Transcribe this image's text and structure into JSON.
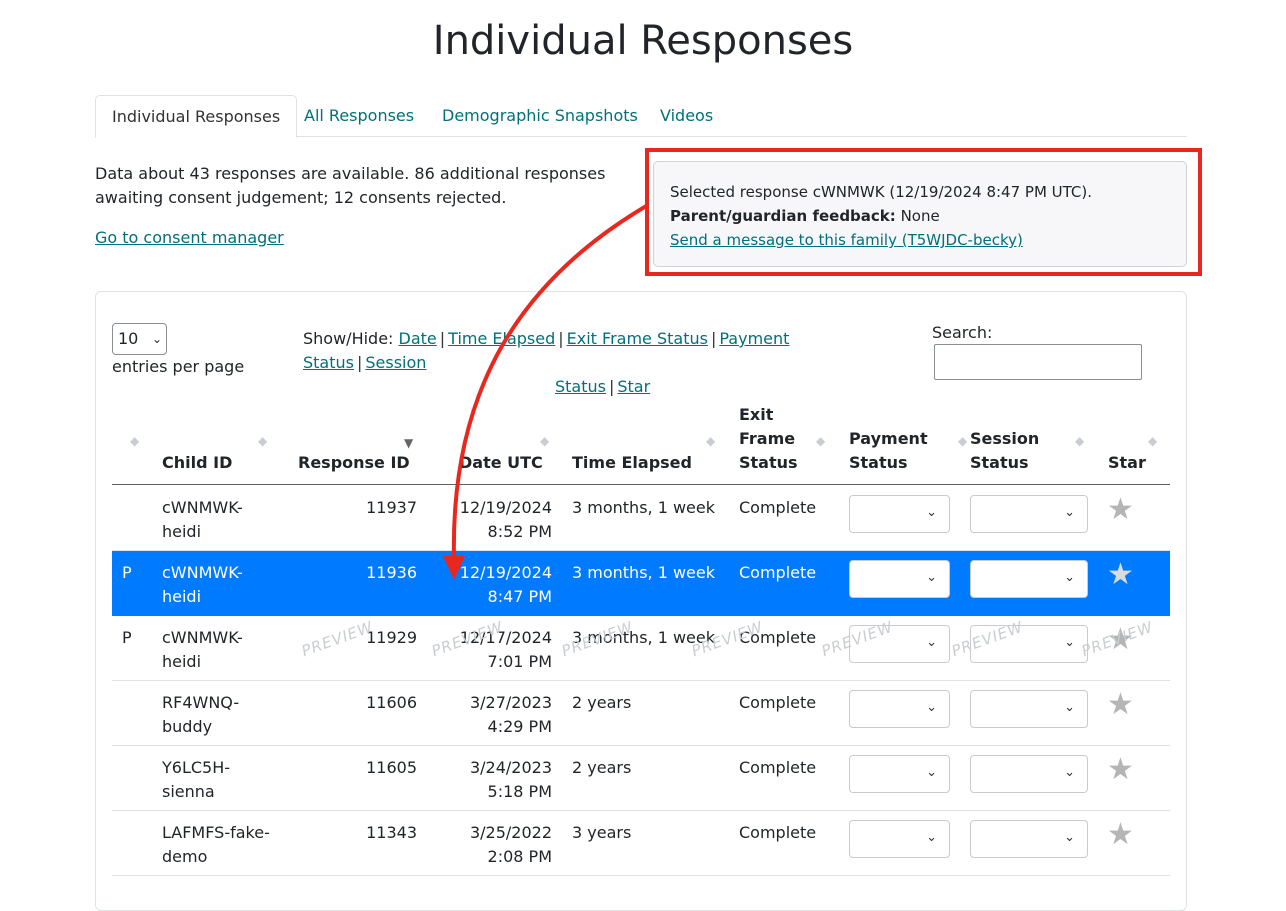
{
  "page": {
    "title": "Individual Responses"
  },
  "tabs": [
    {
      "label": "Individual Responses",
      "active": true
    },
    {
      "label": "All Responses"
    },
    {
      "label": "Demographic Snapshots"
    },
    {
      "label": "Videos"
    }
  ],
  "summary": {
    "line1": "Data about 43 responses are available. 86 additional responses",
    "line2": "awaiting consent judgement; 12 consents rejected.",
    "consent_link": "Go to consent manager"
  },
  "selected_panel": {
    "line": "Selected response cWNMWK (12/19/2024 8:47 PM UTC).",
    "feedback_label": "Parent/guardian feedback:",
    "feedback_value": "None",
    "message_link": "Send a message to this family (T5WJDC-becky)"
  },
  "controls": {
    "entries_value": "10",
    "entries_label": "entries per page",
    "show_hide_label": "Show/Hide:",
    "toggles": [
      "Date",
      "Time Elapsed",
      "Exit Frame Status",
      "Payment Status",
      "Session",
      "Status",
      "Star"
    ],
    "search_label": "Search:"
  },
  "table": {
    "columns": {
      "child_id": "Child ID",
      "response_id": "Response ID",
      "date": "Date UTC",
      "elapsed": "Time Elapsed",
      "exit_1": "Exit",
      "exit_2": "Frame",
      "exit_3": "Status",
      "payment_1": "Payment",
      "payment_2": "Status",
      "session_1": "Session",
      "session_2": "Status",
      "star": "Star"
    },
    "rows": [
      {
        "flag": "",
        "child_1": "cWNMWK-",
        "child_2": "heidi",
        "response_id": "11937",
        "date": "12/19/2024",
        "time": "8:52 PM",
        "elapsed": "3 months, 1 week",
        "exit": "Complete",
        "selected": false
      },
      {
        "flag": "P",
        "child_1": "cWNMWK-",
        "child_2": "heidi",
        "response_id": "11936",
        "date": "12/19/2024",
        "time": "8:47 PM",
        "elapsed": "3 months, 1 week",
        "exit": "Complete",
        "selected": true
      },
      {
        "flag": "P",
        "child_1": "cWNMWK-",
        "child_2": "heidi",
        "response_id": "11929",
        "date": "12/17/2024",
        "time": "7:01 PM",
        "elapsed": "3 months, 1 week",
        "exit": "Complete",
        "selected": false
      },
      {
        "flag": "",
        "child_1": "RF4WNQ-",
        "child_2": "buddy",
        "response_id": "11606",
        "date": "3/27/2023",
        "time": "4:29 PM",
        "elapsed": "2 years",
        "exit": "Complete",
        "selected": false
      },
      {
        "flag": "",
        "child_1": "Y6LC5H-",
        "child_2": "sienna",
        "response_id": "11605",
        "date": "3/24/2023",
        "time": "5:18 PM",
        "elapsed": "2 years",
        "exit": "Complete",
        "selected": false
      },
      {
        "flag": "",
        "child_1": "LAFMFS-fake-",
        "child_2": "demo",
        "response_id": "11343",
        "date": "3/25/2022",
        "time": "2:08 PM",
        "elapsed": "3 years",
        "exit": "Complete",
        "selected": false
      }
    ],
    "watermark": "PREVIEW"
  },
  "colors": {
    "accent": "#00707a",
    "selected_row": "#007bff",
    "annotation": "#e8281f"
  },
  "icons": {
    "sort": "sort-arrows-icon",
    "chevron": "chevron-down-icon",
    "star": "star-icon"
  }
}
